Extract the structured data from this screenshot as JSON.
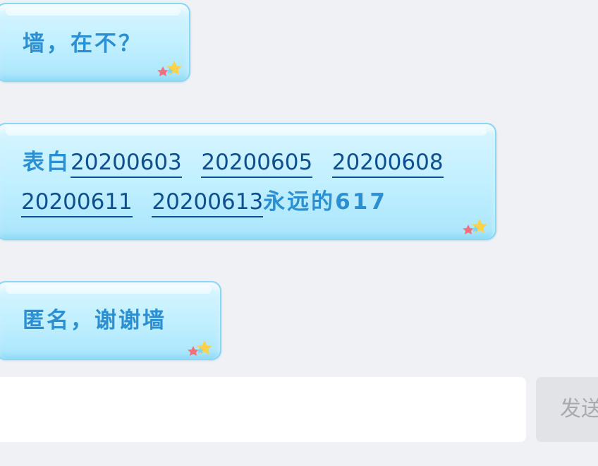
{
  "messages": [
    {
      "text": "墙，在不？"
    },
    {
      "prefix": "表白",
      "links": [
        "20200603",
        "20200605",
        "20200608",
        "20200611",
        "20200613"
      ],
      "suffix": "永远的617"
    },
    {
      "text": "匿名，谢谢墙"
    }
  ],
  "composer": {
    "input_value": "",
    "send_label": "发送"
  },
  "colors": {
    "bubble_fill": "#bfefff",
    "bubble_border": "#88d7f5",
    "text": "#2b8fd1",
    "link": "#0e4f90"
  },
  "icons": [
    "stars-icon"
  ]
}
